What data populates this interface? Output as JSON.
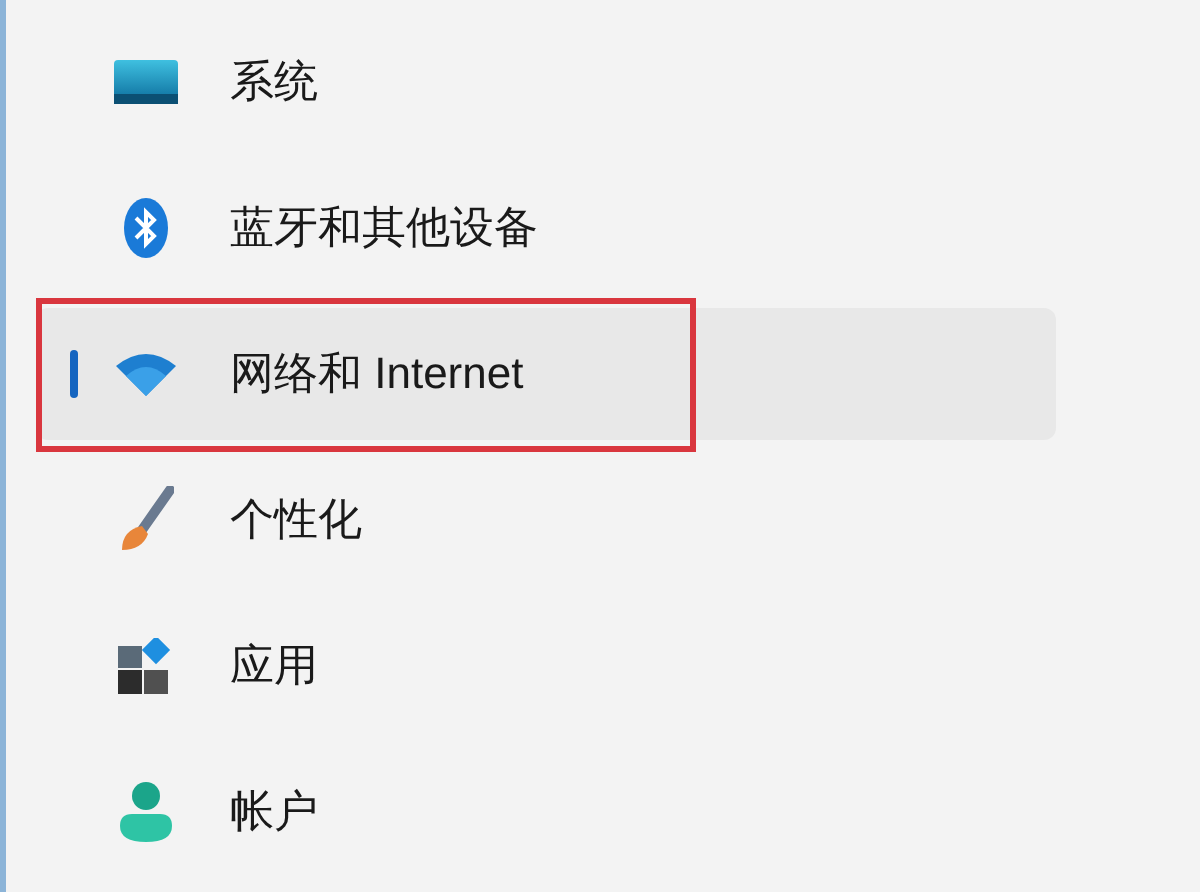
{
  "sidebar": {
    "items": [
      {
        "label": "系统",
        "selected": false,
        "highlighted": false
      },
      {
        "label": "蓝牙和其他设备",
        "selected": false,
        "highlighted": false
      },
      {
        "label": "网络和 Internet",
        "selected": true,
        "highlighted": true
      },
      {
        "label": "个性化",
        "selected": false,
        "highlighted": false
      },
      {
        "label": "应用",
        "selected": false,
        "highlighted": false
      },
      {
        "label": "帐户",
        "selected": false,
        "highlighted": false
      }
    ]
  }
}
